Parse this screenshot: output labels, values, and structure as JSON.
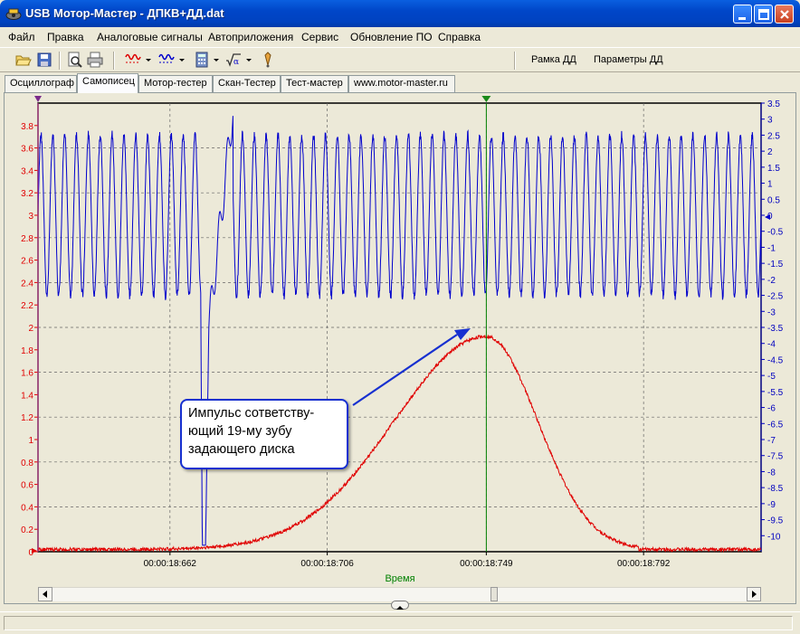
{
  "window": {
    "title": "USB Мотор-Мастер - ДПКВ+ДД.dat"
  },
  "menu": [
    "Файл",
    "Правка",
    "Аналоговые сигналы",
    "Автоприложения",
    "Сервис",
    "Обновление ПО",
    "Справка"
  ],
  "toolbar": {
    "frame_label": "Рамка ДД",
    "params_label": "Параметры ДД",
    "icons": [
      "open-icon",
      "save-icon",
      "print-preview-icon",
      "print-icon",
      "signal-red-icon",
      "signal-blue-icon",
      "calculator-icon",
      "math-icon",
      "probe-icon"
    ]
  },
  "tabs": [
    "Осциллограф",
    "Самописец",
    "Мотор-тестер",
    "Скан-Тестер",
    "Тест-мастер",
    "www.motor-master.ru"
  ],
  "active_tab": 1,
  "annotation": {
    "line1": "Импульс сответству-",
    "line2": "ющий 19-му зубу",
    "line3": "задающего диска"
  },
  "colors": {
    "left_axis": "#e00000",
    "right_axis": "#0000c0",
    "signal_blue": "#0000cc",
    "signal_red": "#e00000",
    "cursor": "#008000",
    "callout_border": "#1730d0"
  },
  "chart_data": {
    "type": "line",
    "xlabel": "Время",
    "x_ticks": [
      "00:00:18:662",
      "00:00:18:706",
      "00:00:18:749",
      "00:00:18:792"
    ],
    "y_left_ticks": [
      "3.8",
      "3.6",
      "3.4",
      "3.2",
      "3",
      "2.8",
      "2.6",
      "2.4",
      "2.2",
      "2",
      "1.8",
      "1.6",
      "1.4",
      "1.2",
      "1",
      "0.8",
      "0.6",
      "0.4",
      "0.2",
      "0"
    ],
    "y_left_range": [
      0,
      4.0
    ],
    "y_right_ticks": [
      "3.5",
      "3",
      "2.5",
      "2",
      "1.5",
      "1",
      "0.5",
      "0",
      "-0.5",
      "-1",
      "-1.5",
      "-2",
      "-2.5",
      "-3",
      "-3.5",
      "-4",
      "-4.5",
      "-5",
      "-5.5",
      "-6",
      "-6.5",
      "-7",
      "-7.5",
      "-8",
      "-8.5",
      "-9",
      "-9.5",
      "-10"
    ],
    "y_right_range": [
      -10.5,
      3.5
    ],
    "grid": true,
    "series": [
      {
        "axis": "right",
        "kind": "sine",
        "cycles": 61,
        "high": 2.5,
        "low": -2.5,
        "gap_start_fraction": 0.225,
        "gap_end_fraction": 0.27,
        "gap_min": -10.3
      },
      {
        "axis": "left",
        "kind": "bell",
        "peak_x_fraction": 0.62,
        "peak_value": 1.92,
        "base_value": 0.02,
        "end_x_fraction": 0.83
      }
    ],
    "cursor_x_fraction": 0.62
  }
}
